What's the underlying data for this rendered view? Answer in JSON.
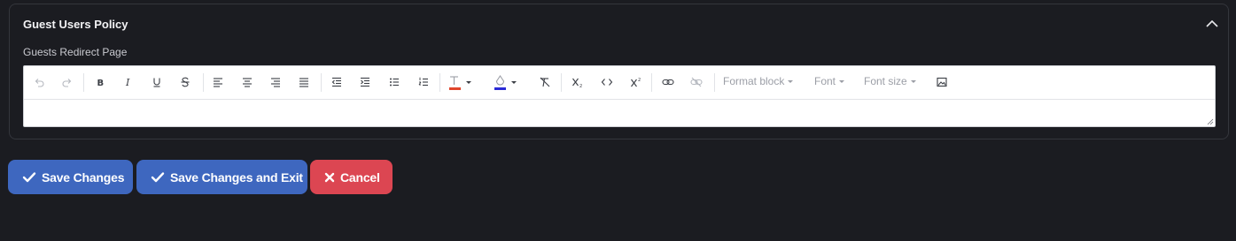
{
  "panel": {
    "title": "Guest Users Policy",
    "field_label": "Guests Redirect Page"
  },
  "editor": {
    "toolbar": {
      "format_block_label": "Format block",
      "font_label": "Font",
      "font_size_label": "Font size",
      "text_color": "#e0452b",
      "highlight_color": "#2a2ad6"
    },
    "content": ""
  },
  "actions": {
    "save_label": "Save Changes",
    "save_exit_label": "Save Changes and Exit",
    "cancel_label": "Cancel"
  }
}
